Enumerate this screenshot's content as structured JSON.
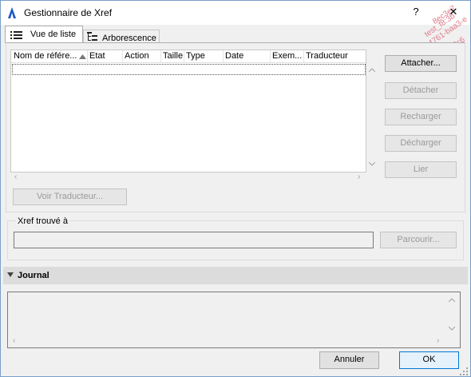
{
  "window": {
    "title": "Gestionnaire de Xref",
    "help_label": "?",
    "close_label": "✕"
  },
  "watermark": {
    "lines": [
      "8ec3e7",
      "test_f8:3b",
      "c-4761-baa3-e",
      "bd7c6"
    ]
  },
  "tabs": [
    {
      "label": "Vue de liste",
      "icon": "list-icon",
      "active": true
    },
    {
      "label": "Arborescence",
      "icon": "tree-icon",
      "active": false
    }
  ],
  "table": {
    "columns": [
      "Nom de référe...",
      "Etat",
      "Action",
      "Taille",
      "Type",
      "Date",
      "Exem...",
      "Traducteur"
    ],
    "sort_column": "Nom de référe...",
    "rows": []
  },
  "buttons": {
    "attach": "Attacher...",
    "detach": "Détacher",
    "reload": "Recharger",
    "unload": "Décharger",
    "bind": "Lier",
    "view_translator": "Voir Traducteur...",
    "browse": "Parcourir...",
    "cancel": "Annuler",
    "ok": "OK"
  },
  "found_at": {
    "label": "Xref trouvé à",
    "value": ""
  },
  "journal": {
    "label": "Journal",
    "expanded": true,
    "content": ""
  },
  "colors": {
    "accent": "#0078d7",
    "window_border": "#7a9ec9",
    "disabled_text": "#9a9a9a"
  }
}
